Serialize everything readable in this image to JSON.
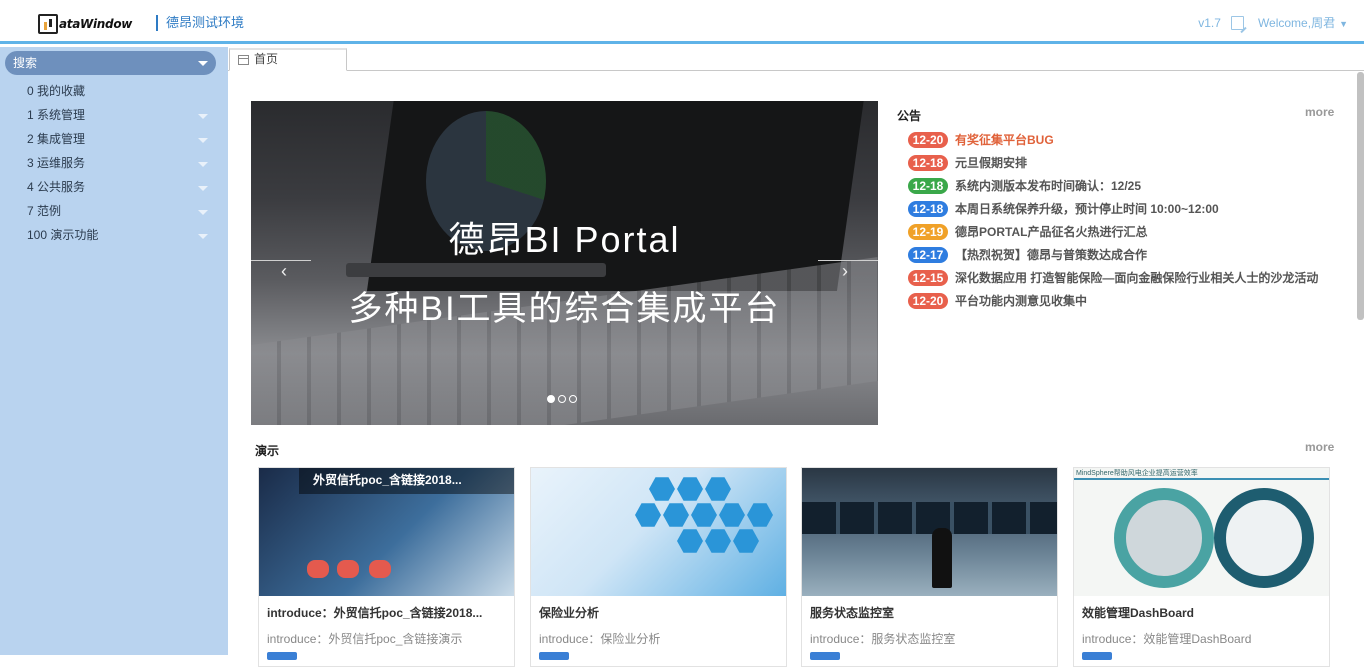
{
  "header": {
    "logo_text": "ataWindow",
    "env_title": "德昂测试环境",
    "version": "v1.7",
    "welcome": "Welcome,周君"
  },
  "sidebar": {
    "search_label": "搜索",
    "items": [
      {
        "label": "0 我的收藏",
        "expandable": false
      },
      {
        "label": "1 系统管理",
        "expandable": true
      },
      {
        "label": "2 集成管理",
        "expandable": true
      },
      {
        "label": "3 运维服务",
        "expandable": true
      },
      {
        "label": "4 公共服务",
        "expandable": true
      },
      {
        "label": "7 范例",
        "expandable": true
      },
      {
        "label": "100 演示功能",
        "expandable": true
      }
    ]
  },
  "tabs": [
    {
      "label": "首页",
      "active": true
    }
  ],
  "carousel": {
    "line1": "德昂BI Portal",
    "line2": "多种BI工具的综合集成平台",
    "slide_count": 3,
    "active_slide": 1
  },
  "notices": {
    "title": "公告",
    "more": "more",
    "items": [
      {
        "date": "12-20",
        "color": "#e8604c",
        "text": "有奖征集平台BUG",
        "hot": true
      },
      {
        "date": "12-18",
        "color": "#e8604c",
        "text": "元旦假期安排",
        "hot": false
      },
      {
        "date": "12-18",
        "color": "#3aa84a",
        "text": "系统内测版本发布时间确认：12/25",
        "hot": false
      },
      {
        "date": "12-18",
        "color": "#2f7de0",
        "text": "本周日系统保养升级，预计停止时间 10:00~12:00",
        "hot": false
      },
      {
        "date": "12-19",
        "color": "#f0a128",
        "text": "德昂PORTAL产品征名火热进行汇总",
        "hot": false
      },
      {
        "date": "12-17",
        "color": "#2f7de0",
        "text": "【热烈祝贺】德昂与普策数达成合作",
        "hot": false
      },
      {
        "date": "12-15",
        "color": "#e8604c",
        "text": "深化数据应用 打造智能保险—面向金融保险行业相关人士的沙龙活动",
        "hot": false
      },
      {
        "date": "12-20",
        "color": "#e8604c",
        "text": "平台功能内测意见收集中",
        "hot": false
      }
    ]
  },
  "demo": {
    "title": "演示",
    "more": "more",
    "cards": [
      {
        "overlay": "外贸信托poc_含链接2018...",
        "title": "introduce：外贸信托poc_含链接2018...",
        "desc": "introduce：外贸信托poc_含链接演示"
      },
      {
        "title": "保险业分析",
        "desc": "introduce：保险业分析"
      },
      {
        "title": "服务状态监控室",
        "desc": "introduce：服务状态监控室"
      },
      {
        "title": "效能管理DashBoard",
        "desc": "introduce：效能管理DashBoard",
        "thumb_caption": "MindSphere帮助风电企业提高运营效率"
      }
    ]
  },
  "colors": {
    "accent": "#2e7bc4",
    "sidebar_bg": "#b9d3ef",
    "search_bg": "#6e90bd",
    "header_rule": "#5fb3e8"
  }
}
